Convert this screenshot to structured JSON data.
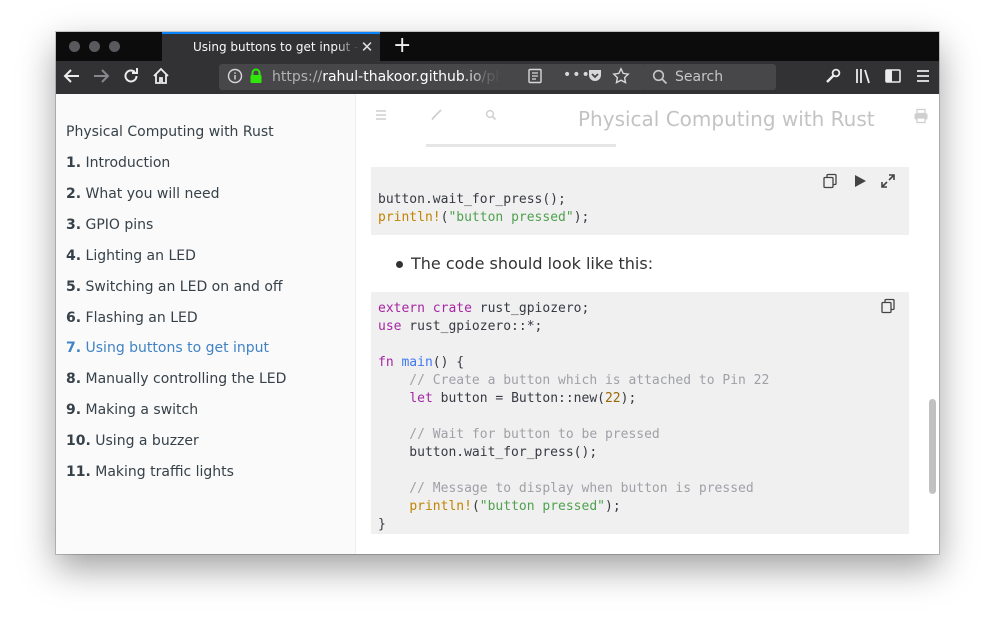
{
  "tab": {
    "title": "Using buttons to get input - Physical Computing with Rust",
    "close_glyph": "✕",
    "new_tab_glyph": "+"
  },
  "urlbar": {
    "scheme": "https://",
    "host": "rahul-thakoor.github.io",
    "path": "/physical-computing-rust/"
  },
  "search": {
    "placeholder": "Search"
  },
  "sidebar": {
    "title": "Physical Computing with Rust",
    "items": [
      {
        "num": "1.",
        "label": "Introduction"
      },
      {
        "num": "2.",
        "label": "What you will need"
      },
      {
        "num": "3.",
        "label": "GPIO pins"
      },
      {
        "num": "4.",
        "label": "Lighting an LED"
      },
      {
        "num": "5.",
        "label": "Switching an LED on and off"
      },
      {
        "num": "6.",
        "label": "Flashing an LED"
      },
      {
        "num": "7.",
        "label": "Using buttons to get input"
      },
      {
        "num": "8.",
        "label": "Manually controlling the LED"
      },
      {
        "num": "9.",
        "label": "Making a switch"
      },
      {
        "num": "10.",
        "label": "Using a buzzer"
      },
      {
        "num": "11.",
        "label": "Making traffic lights"
      }
    ],
    "active_index": 6
  },
  "page": {
    "book_title": "Physical Computing with Rust",
    "code1": {
      "line1": "button.wait_for_press();",
      "line2_macro": "println!",
      "line2_paren_open": "(",
      "line2_str": "\"button pressed\"",
      "line2_end": ");"
    },
    "bullet": "The code should look like this:",
    "code2": {
      "l1_kw": "extern crate",
      "l1_rest": " rust_gpiozero;",
      "l2_kw": "use",
      "l2_rest": " rust_gpiozero::*;",
      "l4_kw": "fn",
      "l4_fn": "main",
      "l4_rest": "() {",
      "l5_cm": "    // Create a button which is attached to Pin 22",
      "l6_kw": "let",
      "l6_rest1": " button = Button::new(",
      "l6_num": "22",
      "l6_rest2": ");",
      "l8_cm": "    // Wait for button to be pressed",
      "l9": "    button.wait_for_press();",
      "l11_cm": "    // Message to display when button is pressed",
      "l12_macro": "println!",
      "l12_paren": "(",
      "l12_str": "\"button pressed\"",
      "l12_end": ");",
      "l13": "}"
    }
  },
  "colors": {
    "accent": "#0a84ff",
    "link_active": "#4183c4",
    "sidebar_bg": "#fafafa",
    "code_bg": "#f0f0f0"
  }
}
